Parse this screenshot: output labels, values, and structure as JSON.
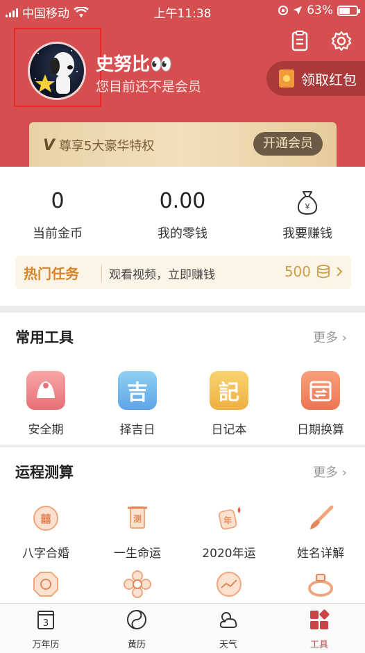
{
  "status_bar": {
    "carrier": "中国移动",
    "time": "上午11:38",
    "battery": "63%",
    "battery_level": 0.63
  },
  "profile": {
    "nickname": "史努比👀",
    "member_status": "您目前还不是会员"
  },
  "hongbao": {
    "label": "领取红包"
  },
  "vip": {
    "text": "尊享5大豪华特权",
    "button": "开通会员"
  },
  "stats": [
    {
      "value": "0",
      "label": "当前金币"
    },
    {
      "value": "0.00",
      "label": "我的零钱"
    },
    {
      "value": "",
      "label": "我要赚钱"
    }
  ],
  "task": {
    "title": "热门任务",
    "desc": "观看视频，立即赚钱",
    "reward": "500"
  },
  "tools": {
    "title": "常用工具",
    "more": "更多",
    "items": [
      {
        "label": "安全期",
        "glyph": ""
      },
      {
        "label": "择吉日",
        "glyph": "吉"
      },
      {
        "label": "日记本",
        "glyph": "記"
      },
      {
        "label": "日期换算",
        "glyph": ""
      }
    ]
  },
  "fortune": {
    "title": "运程测算",
    "more": "更多",
    "items": [
      {
        "label": "八字合婚",
        "glyph": "囍"
      },
      {
        "label": "一生命运",
        "glyph": "测"
      },
      {
        "label": "2020年运",
        "glyph": "年"
      },
      {
        "label": "姓名详解",
        "glyph": ""
      }
    ]
  },
  "tabbar": {
    "items": [
      {
        "label": "万年历",
        "glyph": "3"
      },
      {
        "label": "黄历",
        "glyph": ""
      },
      {
        "label": "天气",
        "glyph": ""
      },
      {
        "label": "工具",
        "glyph": ""
      }
    ]
  },
  "colors": {
    "header": "#d64f50",
    "accent": "#c94545",
    "gold": "#c9a04a"
  }
}
